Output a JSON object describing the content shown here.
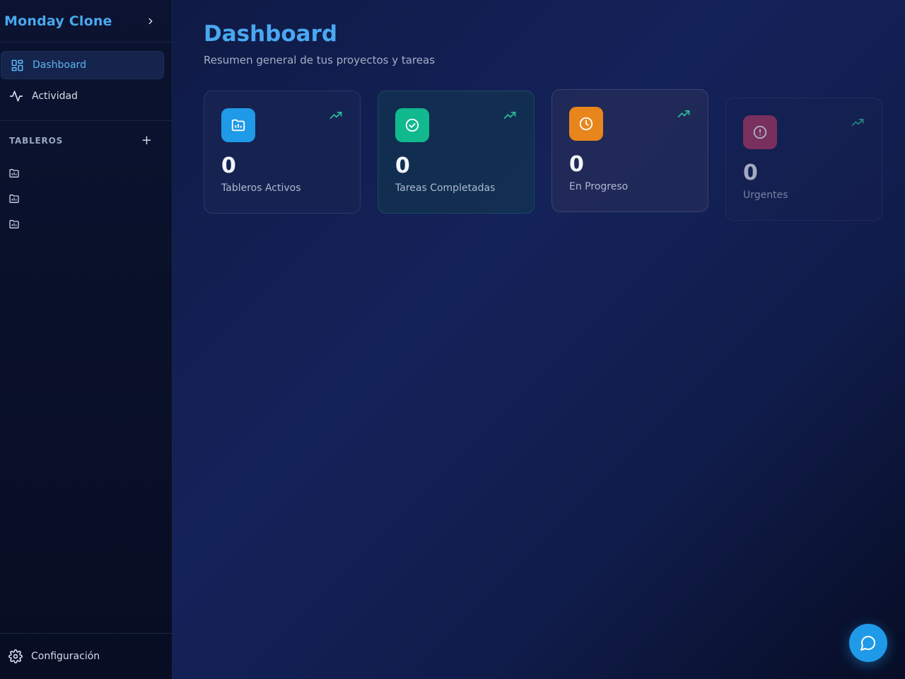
{
  "sidebar": {
    "brand": "Monday Clone",
    "nav": [
      {
        "label": "Dashboard",
        "icon": "grid-icon",
        "active": true
      },
      {
        "label": "Actividad",
        "icon": "activity-icon",
        "active": false
      }
    ],
    "boards_section_title": "TABLEROS",
    "add_symbol": "+",
    "boards_count_visible": 3,
    "footer_label": "Configuración"
  },
  "main": {
    "title": "Dashboard",
    "subtitle": "Resumen general de tus proyectos y tareas",
    "cards": [
      {
        "value": "0",
        "label": "Tableros Activos",
        "icon": "board-folder-icon",
        "color": "#1e9ae8"
      },
      {
        "value": "0",
        "label": "Tareas Completadas",
        "icon": "check-circle-icon",
        "color": "#12b88e"
      },
      {
        "value": "0",
        "label": "En Progreso",
        "icon": "clock-icon",
        "color": "#e8861c"
      },
      {
        "value": "0",
        "label": "Urgentes",
        "icon": "alert-circle-icon",
        "color": "#e0406a"
      }
    ]
  },
  "colors": {
    "accent": "#4aa8f0",
    "trend": "#2cc49a",
    "chat": "#1e9ae8"
  }
}
